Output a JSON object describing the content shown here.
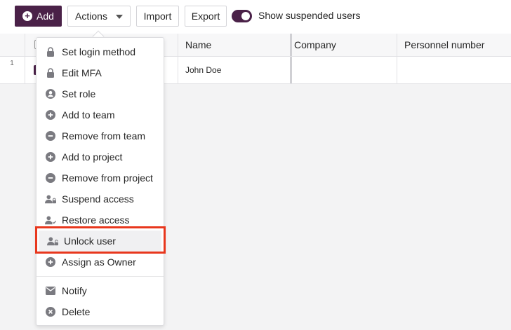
{
  "toolbar": {
    "add_label": "Add",
    "actions_label": "Actions",
    "import_label": "Import",
    "export_label": "Export",
    "toggle_label": "Show suspended users",
    "toggle_on": true
  },
  "grid": {
    "columns": [
      "Name",
      "Company",
      "Personnel number"
    ],
    "rows": [
      {
        "row_number": "1",
        "name": "John Doe",
        "company": "",
        "personnel_number": ""
      }
    ]
  },
  "menu": {
    "items": [
      {
        "label": "Set login method",
        "icon": "lock-icon"
      },
      {
        "label": "Edit MFA",
        "icon": "lock-icon"
      },
      {
        "label": "Set role",
        "icon": "user-circle-icon"
      },
      {
        "label": "Add to team",
        "icon": "plus-circle-icon"
      },
      {
        "label": "Remove from team",
        "icon": "minus-circle-icon"
      },
      {
        "label": "Add to project",
        "icon": "plus-circle-icon"
      },
      {
        "label": "Remove from project",
        "icon": "minus-circle-icon"
      },
      {
        "label": "Suspend access",
        "icon": "user-lock-icon"
      },
      {
        "label": "Restore access",
        "icon": "user-check-icon"
      },
      {
        "label": "Unlock user",
        "icon": "user-unlock-icon"
      },
      {
        "label": "Assign as Owner",
        "icon": "plus-circle-icon"
      },
      {
        "label": "Notify",
        "icon": "envelope-icon"
      },
      {
        "label": "Delete",
        "icon": "x-circle-icon"
      }
    ],
    "highlighted_item": "Unlock user"
  },
  "colors": {
    "brand": "#4a2148",
    "highlight_border": "#e8371d",
    "icon": "#7a7a80"
  }
}
